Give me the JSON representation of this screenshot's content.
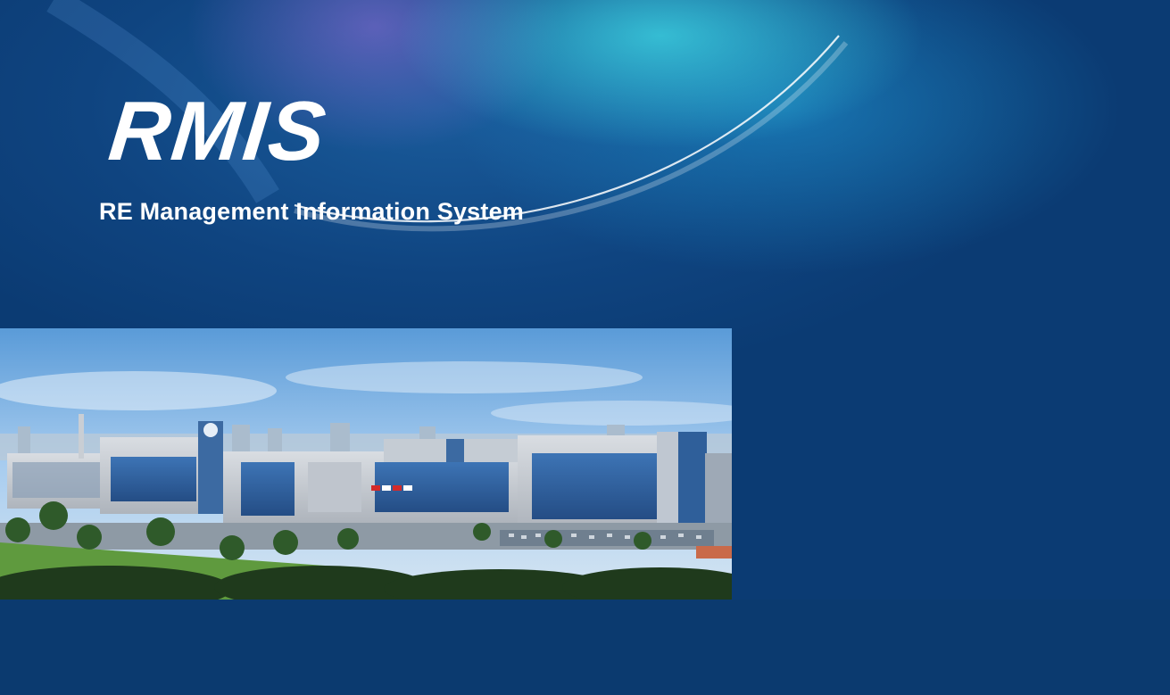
{
  "splash": {
    "logo_text": "RMIS",
    "subtitle": "RE Management Information System"
  },
  "photo": {
    "icon": "campus-building-photo",
    "flag_colors": [
      "#d42a2a",
      "#ffffff",
      "#d42a2a",
      "#ffffff"
    ]
  },
  "theme": {
    "background": "#0b3a6f",
    "accent": "#3fd8e6",
    "text": "#ffffff"
  }
}
